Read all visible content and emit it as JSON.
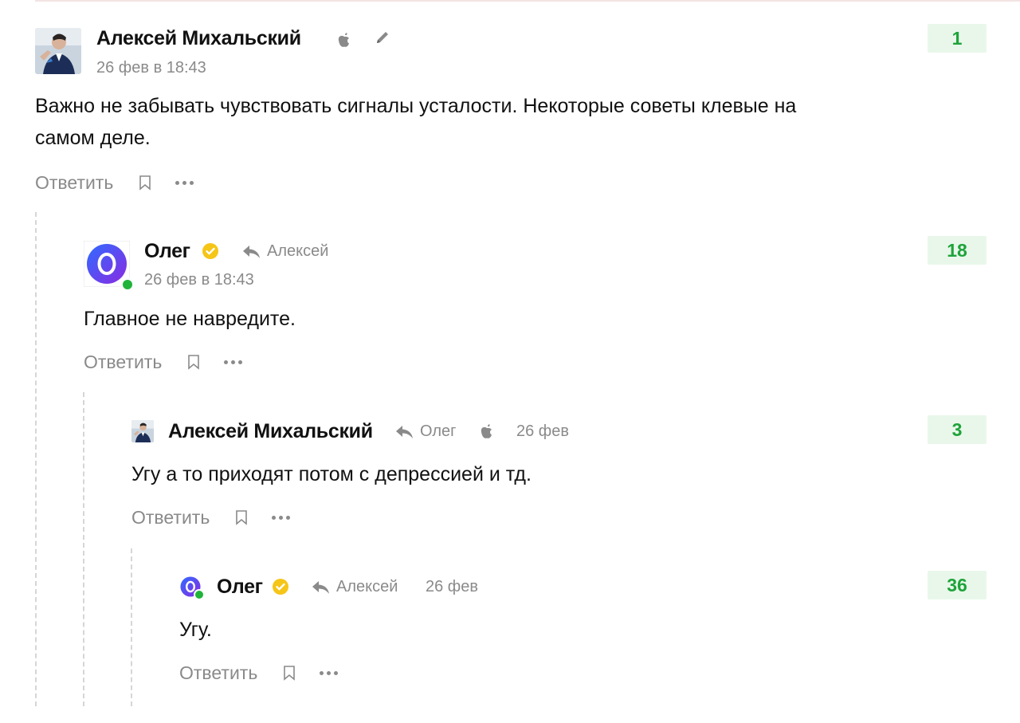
{
  "comments": [
    {
      "author": "Алексей Михальский",
      "date": "26 фев в 18:43",
      "text": "Важно не забывать чувствовать сигналы усталости. Некоторые советы клевые на\nсамом деле.",
      "score": "1",
      "icons": [
        "apple-icon",
        "pencil-icon"
      ]
    },
    {
      "author": "Олег",
      "reply_to": "Алексей",
      "date": "26 фев в 18:43",
      "text": "Главное не навредите.",
      "score": "18",
      "icons": [
        "verified-badge-icon",
        "reply-arrow-icon"
      ]
    },
    {
      "author": "Алексей Михальский",
      "reply_to": "Олег",
      "date": "26 фев",
      "text": "Угу а то приходят потом с депрессией и тд.",
      "score": "3",
      "icons": [
        "reply-arrow-icon",
        "apple-icon"
      ]
    },
    {
      "author": "Олег",
      "reply_to": "Алексей",
      "date": "26 фев",
      "text": "Угу.",
      "score": "36",
      "icons": [
        "verified-badge-icon",
        "reply-arrow-icon"
      ]
    }
  ],
  "actions": {
    "reply_label": "Ответить"
  },
  "colors": {
    "score_bg": "#e8f7ea",
    "score_text": "#1fa33a",
    "verified": "#f5c518",
    "online": "#20b43a",
    "muted": "#8a8a8a"
  }
}
